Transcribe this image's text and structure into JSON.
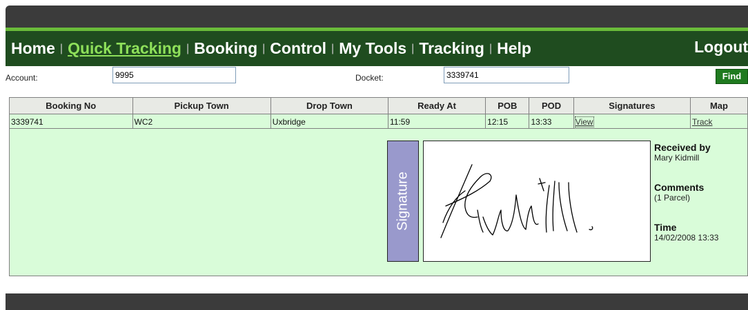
{
  "nav": {
    "items": [
      {
        "label": "Home",
        "active": false
      },
      {
        "label": "Quick Tracking",
        "active": true
      },
      {
        "label": "Booking",
        "active": false
      },
      {
        "label": "Control",
        "active": false
      },
      {
        "label": "My Tools",
        "active": false
      },
      {
        "label": "Tracking",
        "active": false
      },
      {
        "label": "Help",
        "active": false
      }
    ],
    "logout": "Logout"
  },
  "search": {
    "account_label": "Account:",
    "account_value": "9995",
    "docket_label": "Docket:",
    "docket_value": "3339741",
    "find_label": "Find"
  },
  "table": {
    "headers": [
      "Booking No",
      "Pickup Town",
      "Drop Town",
      "Ready At",
      "POB",
      "POD",
      "Signatures",
      "Map"
    ],
    "row": {
      "booking_no": "3339741",
      "pickup_town": "WC2",
      "drop_town": "Uxbridge",
      "ready_at": "11:59",
      "pob": "12:15",
      "pod": "13:33",
      "signatures": "View",
      "map": "Track"
    }
  },
  "detail": {
    "signature_tab": "Signature",
    "received_by_label": "Received by",
    "received_by": "Mary Kidmill",
    "comments_label": "Comments",
    "comments": "(1 Parcel)",
    "time_label": "Time",
    "time": "14/02/2008 13:33"
  },
  "colors": {
    "nav_bg": "#1f4c1f",
    "nav_accent": "#6abb3a",
    "active_link": "#8ee05a",
    "row_bg": "#d9fcd9",
    "signature_tab": "#9999cc",
    "find_button": "#1f7a1f"
  }
}
